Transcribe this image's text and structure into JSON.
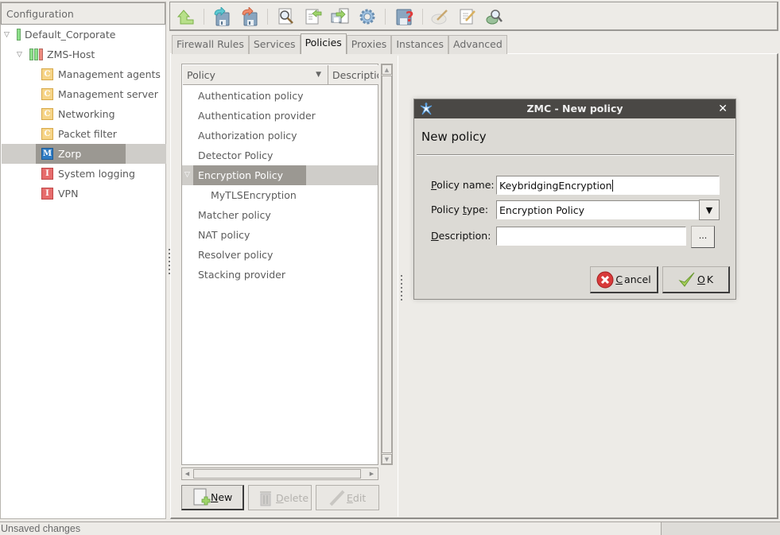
{
  "sidebar": {
    "header": "Configuration",
    "tree": [
      {
        "label": "Default_Corporate",
        "level": 0,
        "expanded": true,
        "icon": "status-bar-green"
      },
      {
        "label": "ZMS-Host",
        "level": 1,
        "expanded": true,
        "icon": "status-bars-green-green-red"
      },
      {
        "label": "Management agents",
        "level": 2,
        "icon": "component-c-icon",
        "badge": "C"
      },
      {
        "label": "Management server",
        "level": 2,
        "icon": "component-c-icon",
        "badge": "C"
      },
      {
        "label": "Networking",
        "level": 2,
        "icon": "component-c-icon",
        "badge": "C"
      },
      {
        "label": "Packet filter",
        "level": 2,
        "icon": "component-c-icon",
        "badge": "C"
      },
      {
        "label": "Zorp",
        "level": 2,
        "icon": "component-m-icon",
        "badge": "M",
        "selected": true
      },
      {
        "label": "System logging",
        "level": 2,
        "icon": "component-i-icon",
        "badge": "I"
      },
      {
        "label": "VPN",
        "level": 2,
        "icon": "component-i-icon",
        "badge": "I"
      }
    ]
  },
  "toolbar": {
    "buttons": [
      {
        "name": "up-icon"
      },
      {
        "name": "save-commit-icon"
      },
      {
        "name": "revert-icon"
      },
      {
        "name": "view-icon"
      },
      {
        "name": "upload-icon"
      },
      {
        "name": "distribute-icon"
      },
      {
        "name": "settings-gear-icon"
      },
      {
        "name": "check-config-icon"
      },
      {
        "name": "clean-icon"
      },
      {
        "name": "edit-notes-icon"
      },
      {
        "name": "search-inspect-icon"
      }
    ]
  },
  "tabs": [
    {
      "label": "Firewall Rules"
    },
    {
      "label": "Services"
    },
    {
      "label": "Policies",
      "active": true
    },
    {
      "label": "Proxies"
    },
    {
      "label": "Instances"
    },
    {
      "label": "Advanced"
    }
  ],
  "policy_list": {
    "columns": [
      "Policy",
      "Description"
    ],
    "rows": [
      {
        "label": "Authentication policy",
        "level": 0
      },
      {
        "label": "Authentication provider",
        "level": 0
      },
      {
        "label": "Authorization policy",
        "level": 0
      },
      {
        "label": "Detector Policy",
        "level": 0
      },
      {
        "label": "Encryption Policy",
        "level": 0,
        "expanded": true,
        "selected": true
      },
      {
        "label": "MyTLSEncryption",
        "level": 1
      },
      {
        "label": "Matcher policy",
        "level": 0
      },
      {
        "label": "NAT policy",
        "level": 0
      },
      {
        "label": "Resolver policy",
        "level": 0
      },
      {
        "label": "Stacking provider",
        "level": 0
      }
    ]
  },
  "actions": {
    "new": {
      "prefix": "",
      "mnemonic": "N",
      "rest": "ew"
    },
    "delete": {
      "mnemonic": "D",
      "rest": "elete"
    },
    "edit": {
      "mnemonic": "E",
      "rest": "dit"
    }
  },
  "dialog": {
    "window_title": "ZMC - New policy",
    "heading": "New policy",
    "fields": {
      "policy_name": {
        "label_mn": "P",
        "label_rest": "olicy name:",
        "value": "KeybridgingEncryption"
      },
      "policy_type": {
        "label_pre": "Policy ",
        "label_mn": "t",
        "label_rest": "ype:",
        "value": "Encryption Policy"
      },
      "description": {
        "label_mn": "D",
        "label_rest": "escription:",
        "value": "",
        "browse": "..."
      }
    },
    "buttons": {
      "cancel": {
        "mnemonic": "C",
        "rest": "ancel"
      },
      "ok": {
        "mnemonic": "O",
        "rest": "K"
      }
    }
  },
  "statusbar": {
    "text": "Unsaved changes"
  }
}
